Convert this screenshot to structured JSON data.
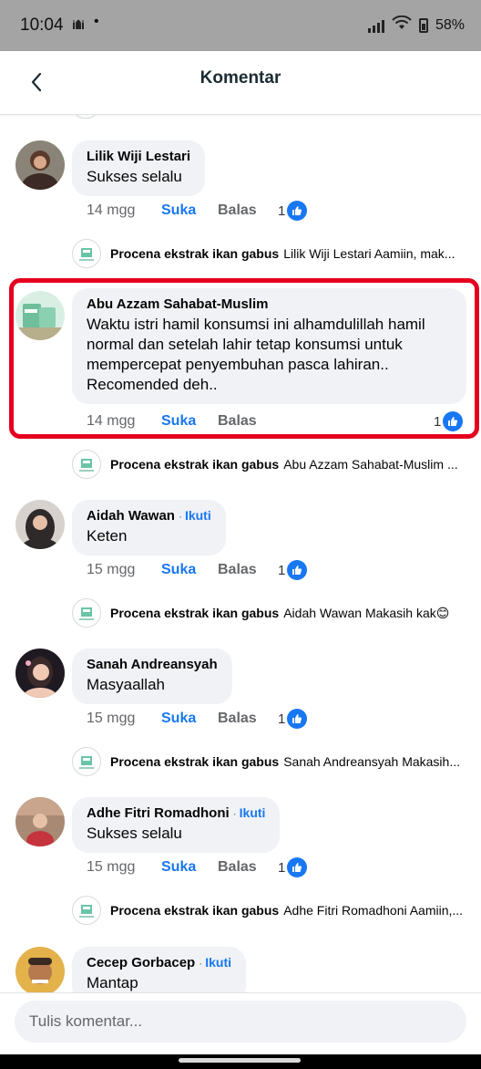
{
  "status_bar": {
    "time": "10:04",
    "notification_icon": "mosque-icon",
    "dot": "•",
    "battery": "58%"
  },
  "header": {
    "title": "Komentar",
    "back_icon": "chevron-left-icon"
  },
  "colors": {
    "accent": "#1877f2",
    "bubble_bg": "#f0f2f5",
    "meta_text": "#65676b",
    "highlight_border": "#e5001f"
  },
  "labels": {
    "like": "Suka",
    "reply": "Balas",
    "follow": "Ikuti",
    "follow_separator": "·"
  },
  "comments": [
    {
      "author": "Lilik Wiji Lestari",
      "text": "Sukses selalu",
      "time": "14 mgg",
      "reactions": "1",
      "reply": {
        "author": "Procena ekstrak ikan gabus",
        "text": "Lilik Wiji Lestari Aamiin, mak..."
      }
    },
    {
      "author": "Abu Azzam Sahabat-Muslim",
      "text": "Waktu istri hamil konsumsi ini alhamdulillah hamil normal dan setelah lahir tetap konsumsi untuk mempercepat penyembuhan pasca lahiran.. Recomended deh..",
      "time": "14 mgg",
      "reactions": "1",
      "highlighted": true,
      "reply": {
        "author": "Procena ekstrak ikan gabus",
        "text": "Abu Azzam Sahabat-Muslim ..."
      }
    },
    {
      "author": "Aidah Wawan",
      "follow": true,
      "text": "Keten",
      "time": "15 mgg",
      "reactions": "1",
      "reply": {
        "author": "Procena ekstrak ikan gabus",
        "text": "Aidah Wawan Makasih kak😊"
      }
    },
    {
      "author": "Sanah Andreansyah",
      "text": "Masyaallah",
      "time": "15 mgg",
      "reactions": "1",
      "reply": {
        "author": "Procena ekstrak ikan gabus",
        "text": "Sanah Andreansyah Makasih..."
      }
    },
    {
      "author": "Adhe Fitri Romadhoni",
      "follow": true,
      "text": "Sukses selalu",
      "time": "15 mgg",
      "reactions": "1",
      "reply": {
        "author": "Procena ekstrak ikan gabus",
        "text": "Adhe Fitri Romadhoni Aamiin,..."
      }
    },
    {
      "author": "Cecep Gorbacep",
      "follow": true,
      "text": "Mantap"
    }
  ],
  "composer": {
    "placeholder": "Tulis komentar..."
  }
}
